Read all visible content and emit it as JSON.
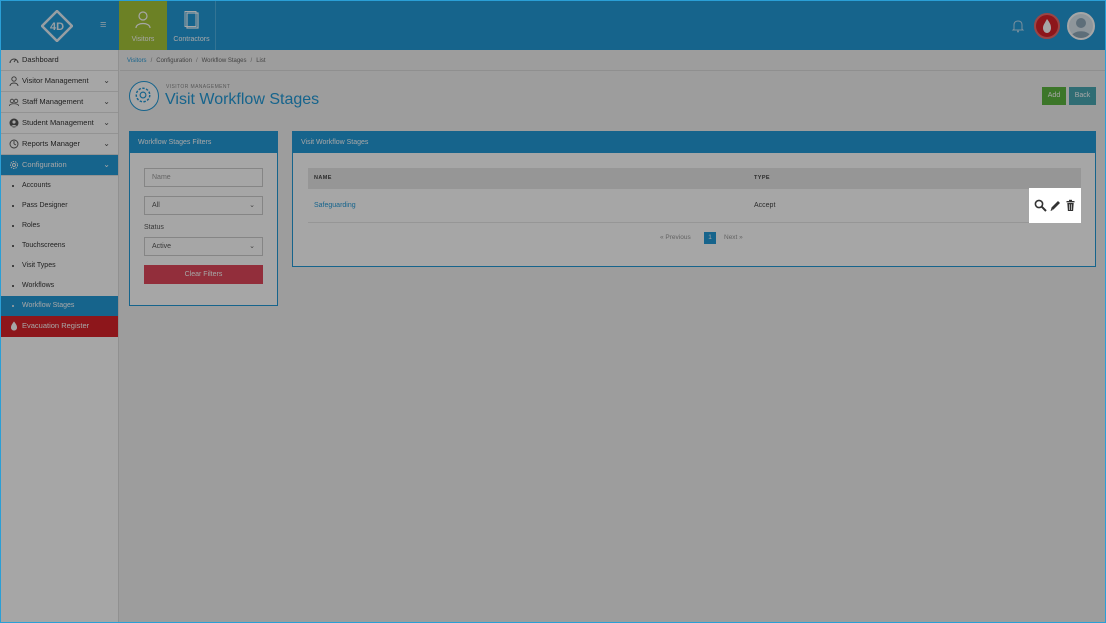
{
  "topbar": {
    "logo_text": "4D",
    "tabs": [
      {
        "label": "Visitors",
        "icon": "person-icon",
        "active": true
      },
      {
        "label": "Contractors",
        "icon": "document-icon",
        "active": false
      }
    ],
    "colors": {
      "primary": "#239ad8",
      "active_tab": "#a6c73a",
      "evacuation": "#d9222a"
    }
  },
  "sidebar": {
    "items": [
      {
        "label": "Dashboard",
        "icon": "dashboard-icon"
      },
      {
        "label": "Visitor Management",
        "icon": "person-icon"
      },
      {
        "label": "Staff Management",
        "icon": "staff-icon"
      },
      {
        "label": "Student Management",
        "icon": "student-icon"
      },
      {
        "label": "Reports Manager",
        "icon": "reports-icon"
      },
      {
        "label": "Configuration",
        "icon": "gear-icon"
      }
    ],
    "config_sub": [
      {
        "label": "Accounts"
      },
      {
        "label": "Pass Designer"
      },
      {
        "label": "Roles"
      },
      {
        "label": "Touchscreens"
      },
      {
        "label": "Visit Types"
      },
      {
        "label": "Workflows"
      },
      {
        "label": "Workflow Stages",
        "active": true
      }
    ],
    "evacuation": {
      "label": "Evacuation Register",
      "icon": "flame-icon"
    }
  },
  "breadcrumb": [
    "Visitors",
    "Configuration",
    "Workflow Stages",
    "List"
  ],
  "header": {
    "section": "VISITOR MANAGEMENT",
    "title": "Visit Workflow Stages",
    "add_label": "Add",
    "back_label": "Back"
  },
  "filters": {
    "title": "Workflow Stages Filters",
    "name_placeholder": "Name",
    "type_value": "All",
    "status_label": "Status",
    "status_value": "Active",
    "clear_label": "Clear Filters"
  },
  "table": {
    "title": "Visit Workflow Stages",
    "columns": [
      "NAME",
      "TYPE"
    ],
    "rows": [
      {
        "name": "Safeguarding",
        "type": "Accept"
      }
    ],
    "pager": {
      "prev": "Previous",
      "page": "1",
      "next": "Next"
    }
  }
}
